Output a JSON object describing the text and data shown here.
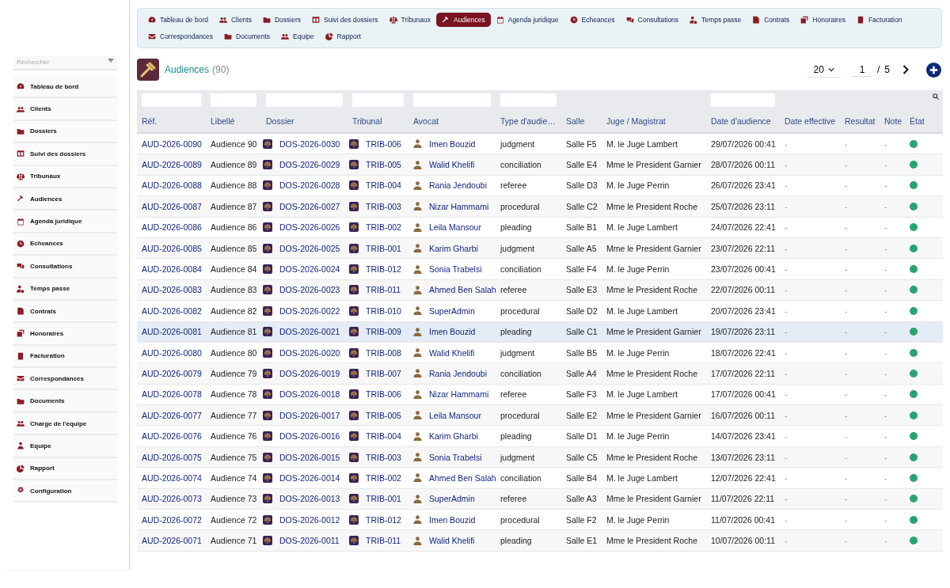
{
  "top_nav": [
    {
      "label": "Tableau de bord",
      "selected": false
    },
    {
      "label": "Clients",
      "selected": false
    },
    {
      "label": "Dossiers",
      "selected": false
    },
    {
      "label": "Suivi des dossiers",
      "selected": false
    },
    {
      "label": "Tribunaux",
      "selected": false
    },
    {
      "label": "Audiences",
      "selected": true
    },
    {
      "label": "Agenda juridique",
      "selected": false
    },
    {
      "label": "Echeances",
      "selected": false
    },
    {
      "label": "Consultations",
      "selected": false
    },
    {
      "label": "Temps passe",
      "selected": false
    },
    {
      "label": "Contrats",
      "selected": false
    },
    {
      "label": "Honoraires",
      "selected": false
    },
    {
      "label": "Facturation",
      "selected": false
    },
    {
      "label": "Correspondances",
      "selected": false
    },
    {
      "label": "Documents",
      "selected": false
    },
    {
      "label": "Equipe",
      "selected": false
    },
    {
      "label": "Rapport",
      "selected": false
    }
  ],
  "sidebar": {
    "search_placeholder": "Rechercher",
    "items": [
      "Tableau de bord",
      "Clients",
      "Dossiers",
      "Suivi des dossiers",
      "Tribunaux",
      "Audiences",
      "Agenda juridique",
      "Echeances",
      "Consultations",
      "Temps passe",
      "Contrats",
      "Honoraires",
      "Facturation",
      "Correspondances",
      "Documents",
      "Charge de l'equipe",
      "Equipe",
      "Rapport",
      "Configuration"
    ]
  },
  "page": {
    "title": "Audiences",
    "count": "(90)",
    "page_size": "20",
    "page": "1",
    "page_separator": "/",
    "page_total": "5"
  },
  "table": {
    "columns": [
      {
        "label": "Réf.",
        "filter": true
      },
      {
        "label": "Libellé",
        "filter": true
      },
      {
        "label": "Dossier",
        "filter": true
      },
      {
        "label": "Tribunal",
        "filter": true
      },
      {
        "label": "Avocat",
        "filter": true
      },
      {
        "label": "Type d'audie…",
        "filter": true
      },
      {
        "label": "Salle",
        "filter": false
      },
      {
        "label": "Juge / Magistrat",
        "filter": false
      },
      {
        "label": "Date d'audience",
        "filter": true
      },
      {
        "label": "Date effective",
        "filter": false
      },
      {
        "label": "Resultat",
        "filter": false
      },
      {
        "label": "Note",
        "filter": false
      },
      {
        "label": "État",
        "filter": false
      }
    ],
    "rows": [
      {
        "ref": "AUD-2026-0090",
        "label": "Audience 90",
        "dossier": "DOS-2026-0030",
        "tribunal": "TRIB-006",
        "avocat": "Imen Bouzid",
        "type": "judgment",
        "salle": "Salle F5",
        "juge": "M. le Juge Lambert",
        "date": "29/07/2026 00:41",
        "date_effective": "-",
        "resultat": "-",
        "note": "-",
        "color": "#2aa36f",
        "selected": false
      },
      {
        "ref": "AUD-2026-0089",
        "label": "Audience 89",
        "dossier": "DOS-2026-0029",
        "tribunal": "TRIB-005",
        "avocat": "Walid Khelifi",
        "type": "conciliation",
        "salle": "Salle E4",
        "juge": "Mme le President Garnier",
        "date": "28/07/2026 00:11",
        "date_effective": "-",
        "resultat": "-",
        "note": "-",
        "color": "#2aa36f",
        "selected": false
      },
      {
        "ref": "AUD-2026-0088",
        "label": "Audience 88",
        "dossier": "DOS-2026-0028",
        "tribunal": "TRIB-004",
        "avocat": "Rania Jendoubi",
        "type": "referee",
        "salle": "Salle D3",
        "juge": "M. le Juge Perrin",
        "date": "26/07/2026 23:41",
        "date_effective": "-",
        "resultat": "-",
        "note": "-",
        "color": "#2aa36f",
        "selected": false
      },
      {
        "ref": "AUD-2026-0087",
        "label": "Audience 87",
        "dossier": "DOS-2026-0027",
        "tribunal": "TRIB-003",
        "avocat": "Nizar Hammami",
        "type": "procedural",
        "salle": "Salle C2",
        "juge": "Mme le President Roche",
        "date": "25/07/2026 23:11",
        "date_effective": "-",
        "resultat": "-",
        "note": "-",
        "color": "#2aa36f",
        "selected": false
      },
      {
        "ref": "AUD-2026-0086",
        "label": "Audience 86",
        "dossier": "DOS-2026-0026",
        "tribunal": "TRIB-002",
        "avocat": "Leila Mansour",
        "type": "pleading",
        "salle": "Salle B1",
        "juge": "M. le Juge Lambert",
        "date": "24/07/2026 22:41",
        "date_effective": "-",
        "resultat": "-",
        "note": "-",
        "color": "#2aa36f",
        "selected": false
      },
      {
        "ref": "AUD-2026-0085",
        "label": "Audience 85",
        "dossier": "DOS-2026-0025",
        "tribunal": "TRIB-001",
        "avocat": "Karim Gharbi",
        "type": "judgment",
        "salle": "Salle A5",
        "juge": "Mme le President Garnier",
        "date": "23/07/2026 22:11",
        "date_effective": "-",
        "resultat": "-",
        "note": "-",
        "color": "#2aa36f",
        "selected": false
      },
      {
        "ref": "AUD-2026-0084",
        "label": "Audience 84",
        "dossier": "DOS-2026-0024",
        "tribunal": "TRIB-012",
        "avocat": "Sonia Trabelsi",
        "type": "conciliation",
        "salle": "Salle F4",
        "juge": "M. le Juge Perrin",
        "date": "23/07/2026 00:41",
        "date_effective": "-",
        "resultat": "-",
        "note": "-",
        "color": "#2aa36f",
        "selected": false
      },
      {
        "ref": "AUD-2026-0083",
        "label": "Audience 83",
        "dossier": "DOS-2026-0023",
        "tribunal": "TRIB-011",
        "avocat": "Ahmed Ben Salah",
        "type": "referee",
        "salle": "Salle E3",
        "juge": "Mme le President Roche",
        "date": "22/07/2026 00:11",
        "date_effective": "-",
        "resultat": "-",
        "note": "-",
        "color": "#2aa36f",
        "selected": false
      },
      {
        "ref": "AUD-2026-0082",
        "label": "Audience 82",
        "dossier": "DOS-2026-0022",
        "tribunal": "TRIB-010",
        "avocat": "SuperAdmin",
        "type": "procedural",
        "salle": "Salle D2",
        "juge": "M. le Juge Lambert",
        "date": "20/07/2026 23:41",
        "date_effective": "-",
        "resultat": "-",
        "note": "-",
        "color": "#2aa36f",
        "selected": false
      },
      {
        "ref": "AUD-2026-0081",
        "label": "Audience 81",
        "dossier": "DOS-2026-0021",
        "tribunal": "TRIB-009",
        "avocat": "Imen Bouzid",
        "type": "pleading",
        "salle": "Salle C1",
        "juge": "Mme le President Garnier",
        "date": "19/07/2026 23:11",
        "date_effective": "-",
        "resultat": "-",
        "note": "-",
        "color": "#2aa36f",
        "selected": true
      },
      {
        "ref": "AUD-2026-0080",
        "label": "Audience 80",
        "dossier": "DOS-2026-0020",
        "tribunal": "TRIB-008",
        "avocat": "Walid Khelifi",
        "type": "judgment",
        "salle": "Salle B5",
        "juge": "M. le Juge Perrin",
        "date": "18/07/2026 22:41",
        "date_effective": "-",
        "resultat": "-",
        "note": "-",
        "color": "#2aa36f",
        "selected": false
      },
      {
        "ref": "AUD-2026-0079",
        "label": "Audience 79",
        "dossier": "DOS-2026-0019",
        "tribunal": "TRIB-007",
        "avocat": "Rania Jendoubi",
        "type": "conciliation",
        "salle": "Salle A4",
        "juge": "Mme le President Roche",
        "date": "17/07/2026 22:11",
        "date_effective": "-",
        "resultat": "-",
        "note": "-",
        "color": "#2aa36f",
        "selected": false
      },
      {
        "ref": "AUD-2026-0078",
        "label": "Audience 78",
        "dossier": "DOS-2026-0018",
        "tribunal": "TRIB-006",
        "avocat": "Nizar Hammami",
        "type": "referee",
        "salle": "Salle F3",
        "juge": "M. le Juge Lambert",
        "date": "17/07/2026 00:41",
        "date_effective": "-",
        "resultat": "-",
        "note": "-",
        "color": "#2aa36f",
        "selected": false
      },
      {
        "ref": "AUD-2026-0077",
        "label": "Audience 77",
        "dossier": "DOS-2026-0017",
        "tribunal": "TRIB-005",
        "avocat": "Leila Mansour",
        "type": "procedural",
        "salle": "Salle E2",
        "juge": "Mme le President Garnier",
        "date": "16/07/2026 00:11",
        "date_effective": "-",
        "resultat": "-",
        "note": "-",
        "color": "#2aa36f",
        "selected": false
      },
      {
        "ref": "AUD-2026-0076",
        "label": "Audience 76",
        "dossier": "DOS-2026-0016",
        "tribunal": "TRIB-004",
        "avocat": "Karim Gharbi",
        "type": "pleading",
        "salle": "Salle D1",
        "juge": "M. le Juge Perrin",
        "date": "14/07/2026 23:41",
        "date_effective": "-",
        "resultat": "-",
        "note": "-",
        "color": "#2aa36f",
        "selected": false
      },
      {
        "ref": "AUD-2026-0075",
        "label": "Audience 75",
        "dossier": "DOS-2026-0015",
        "tribunal": "TRIB-003",
        "avocat": "Sonia Trabelsi",
        "type": "judgment",
        "salle": "Salle C5",
        "juge": "Mme le President Roche",
        "date": "13/07/2026 23:11",
        "date_effective": "-",
        "resultat": "-",
        "note": "-",
        "color": "#2aa36f",
        "selected": false
      },
      {
        "ref": "AUD-2026-0074",
        "label": "Audience 74",
        "dossier": "DOS-2026-0014",
        "tribunal": "TRIB-002",
        "avocat": "Ahmed Ben Salah",
        "type": "conciliation",
        "salle": "Salle B4",
        "juge": "M. le Juge Lambert",
        "date": "12/07/2026 22:41",
        "date_effective": "-",
        "resultat": "-",
        "note": "-",
        "color": "#2aa36f",
        "selected": false
      },
      {
        "ref": "AUD-2026-0073",
        "label": "Audience 73",
        "dossier": "DOS-2026-0013",
        "tribunal": "TRIB-001",
        "avocat": "SuperAdmin",
        "type": "referee",
        "salle": "Salle A3",
        "juge": "Mme le President Garnier",
        "date": "11/07/2026 22:11",
        "date_effective": "-",
        "resultat": "-",
        "note": "-",
        "color": "#2aa36f",
        "selected": false
      },
      {
        "ref": "AUD-2026-0072",
        "label": "Audience 72",
        "dossier": "DOS-2026-0012",
        "tribunal": "TRIB-012",
        "avocat": "Imen Bouzid",
        "type": "procedural",
        "salle": "Salle F2",
        "juge": "M. le Juge Perrin",
        "date": "11/07/2026 00:41",
        "date_effective": "-",
        "resultat": "-",
        "note": "-",
        "color": "#2aa36f",
        "selected": false
      },
      {
        "ref": "AUD-2026-0071",
        "label": "Audience 71",
        "dossier": "DOS-2026-0011",
        "tribunal": "TRIB-011",
        "avocat": "Walid Khelifi",
        "type": "pleading",
        "salle": "Salle E1",
        "juge": "Mme le President Roche",
        "date": "10/07/2026 00:11",
        "date_effective": "-",
        "resultat": "-",
        "note": "-",
        "color": "#2aa36f",
        "selected": false
      }
    ]
  }
}
